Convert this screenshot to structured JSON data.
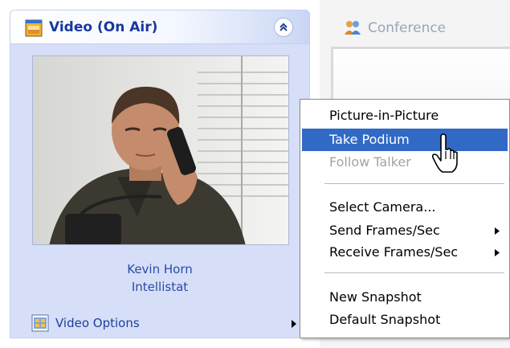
{
  "video_panel": {
    "title": "Video (On Air)",
    "caller_name": "Kevin Horn",
    "caller_org": "Intellistat",
    "options_label": "Video Options"
  },
  "conference_panel": {
    "title": "Conference"
  },
  "context_menu": {
    "items": [
      {
        "label": "Picture-in-Picture",
        "state": "normal"
      },
      {
        "label": "Take Podium",
        "state": "highlighted"
      },
      {
        "label": "Follow Talker",
        "state": "disabled"
      },
      {
        "label": "Select Camera...",
        "state": "normal"
      },
      {
        "label": "Send Frames/Sec",
        "state": "normal",
        "submenu": true
      },
      {
        "label": "Receive Frames/Sec",
        "state": "normal",
        "submenu": true
      },
      {
        "label": "New Snapshot",
        "state": "normal"
      },
      {
        "label": "Default Snapshot",
        "state": "normal"
      }
    ]
  },
  "colors": {
    "highlight": "#316ac5",
    "panel_title": "#17389e",
    "panel_bg": "#d6dff7"
  },
  "icons": [
    "video-window-icon",
    "collapse-chevrons-icon",
    "video-options-icon",
    "conference-icon",
    "submenu-arrow-icon",
    "hand-cursor-icon"
  ]
}
